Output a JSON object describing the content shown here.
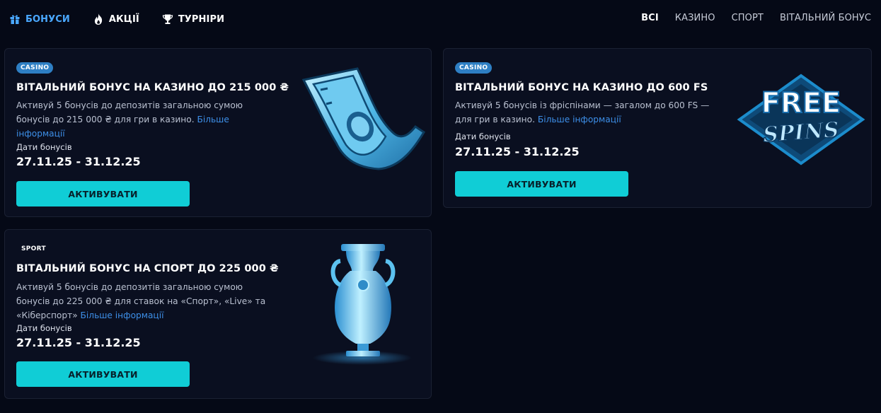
{
  "nav": {
    "items": [
      {
        "label": "БОНУСИ",
        "icon": "gift-icon",
        "active": true
      },
      {
        "label": "АКЦІЇ",
        "icon": "flame-icon",
        "active": false
      },
      {
        "label": "ТУРНІРИ",
        "icon": "trophy-icon",
        "active": false
      }
    ],
    "filters": [
      {
        "label": "ВСІ",
        "active": true
      },
      {
        "label": "КАЗИНО",
        "active": false
      },
      {
        "label": "СПОРТ",
        "active": false
      },
      {
        "label": "ВІТАЛЬНИЙ БОНУС",
        "active": false
      }
    ]
  },
  "cards": [
    {
      "badge": "CASINO",
      "title": "ВІТАЛЬНИЙ БОНУС НА КАЗИНО ДО 215 000 ₴",
      "desc_line1": "Активуй 5 бонусів до депозитів загальною сумою",
      "desc_line2": "бонусів до 215 000 ₴ для гри в казино.",
      "more": "Більше",
      "more2": "інформації",
      "dates_label": "Дати бонусів",
      "dates": "27.11.25 - 31.12.25",
      "button": "АКТИВУВАТИ",
      "art": "banknote-icon"
    },
    {
      "badge": "CASINO",
      "title": "ВІТАЛЬНИЙ БОНУС НА КАЗИНО ДО 600 FS",
      "desc_line1": "Активуй 5 бонусів із фріспінами — загалом до 600 FS —",
      "desc_line2": "для гри в казино.",
      "more": "Більше інформації",
      "dates_label": "Дати бонусів",
      "dates": "27.11.25 - 31.12.25",
      "button": "АКТИВУВАТИ",
      "art": "free-spins-logo",
      "art_word1": "FREE",
      "art_word2": "SPINS"
    },
    {
      "badge": "SPORT",
      "title": "ВІТАЛЬНИЙ БОНУС НА СПОРТ ДО 225 000 ₴",
      "desc_line1": "Активуй 5 бонусів до депозитів загальною сумою",
      "desc_line2": "бонусів до 225 000 ₴ для ставок на «Спорт», «Live» та",
      "desc_line3": "«Кіберспорт»",
      "more": "Більше інформації",
      "dates_label": "Дати бонусів",
      "dates": "27.11.25 - 31.12.25",
      "button": "АКТИВУВАТИ",
      "art": "trophy-cup-icon"
    }
  ],
  "colors": {
    "background": "#050916",
    "card": "#0a0f20",
    "accent": "#10cdd6",
    "link": "#3d8fe8",
    "badge_casino": "#2e7fc4"
  }
}
